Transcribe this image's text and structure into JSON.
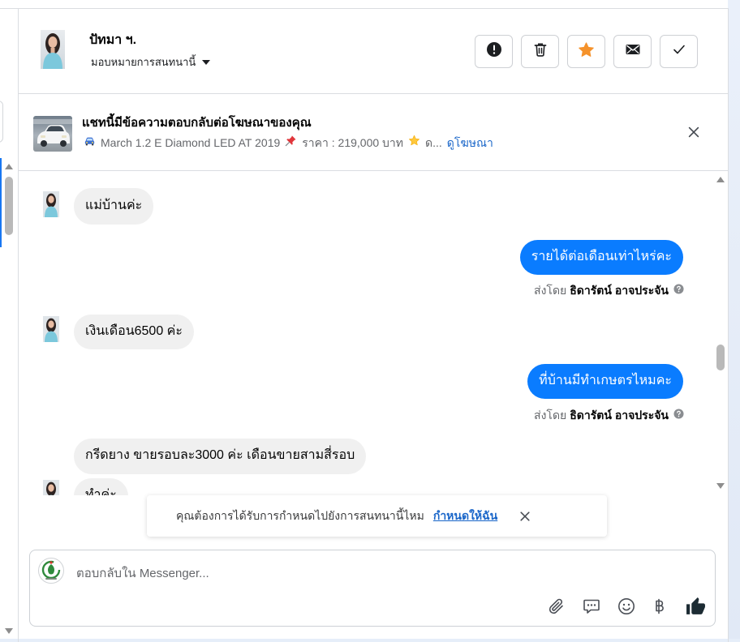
{
  "colors": {
    "accent": "#0a7cff",
    "link": "#1a66c9",
    "star": "#f5922b",
    "incoming_bubble": "#f0f0f0",
    "thumbs_up": "#1c2b33"
  },
  "header": {
    "contact_name": "ปัทมา ฯ.",
    "assign_label": "มอบหมายการสนทนานี้",
    "actions": [
      {
        "icon": "exclamation-circle-icon"
      },
      {
        "icon": "trash-icon"
      },
      {
        "icon": "star-icon"
      },
      {
        "icon": "envelope-icon"
      },
      {
        "icon": "check-icon"
      }
    ]
  },
  "ad_banner": {
    "title": "แชทนี้มีข้อความตอบกลับต่อโฆษณาของคุณ",
    "segments": [
      {
        "icon": "car-emoji-icon",
        "text": "March 1.2 E Diamond LED AT 2019"
      },
      {
        "icon": "pushpin-emoji-icon",
        "text": "ราคา : 219,000 บาท"
      },
      {
        "icon": "star-emoji-icon",
        "text": "ด..."
      }
    ],
    "link_label": "ดูโฆษณา"
  },
  "messages": [
    {
      "outgoing": false,
      "text": "แม่บ้านค่ะ"
    },
    {
      "outgoing": true,
      "text": "รายได้ต่อเดือนเท่าไหร่คะ",
      "sent_by_label": "ส่งโดย",
      "sender": "ธิดารัตน์ อาจประจัน"
    },
    {
      "outgoing": false,
      "text": "เงินเดือน6500 ค่ะ"
    },
    {
      "outgoing": true,
      "text": "ที่บ้านมีทำเกษตรไหมคะ",
      "sent_by_label": "ส่งโดย",
      "sender": "ธิดารัตน์ อาจประจัน"
    },
    {
      "outgoing": false,
      "text": "กรีดยาง ขายรอบละ3000 ค่ะ เดือนขายสามสี่รอบ"
    },
    {
      "outgoing": false,
      "text": "ทำค่ะ"
    }
  ],
  "assign_prompt": {
    "text": "คุณต้องการได้รับการกำหนดไปยังการสนทนานี้ไหม",
    "action_label": "กำหนดให้ฉัน"
  },
  "composer": {
    "placeholder": "ตอบกลับใน Messenger...",
    "tools": [
      "paperclip-icon",
      "saved-reply-icon",
      "emoji-icon",
      "baht-icon",
      "thumbs-up-icon"
    ]
  }
}
